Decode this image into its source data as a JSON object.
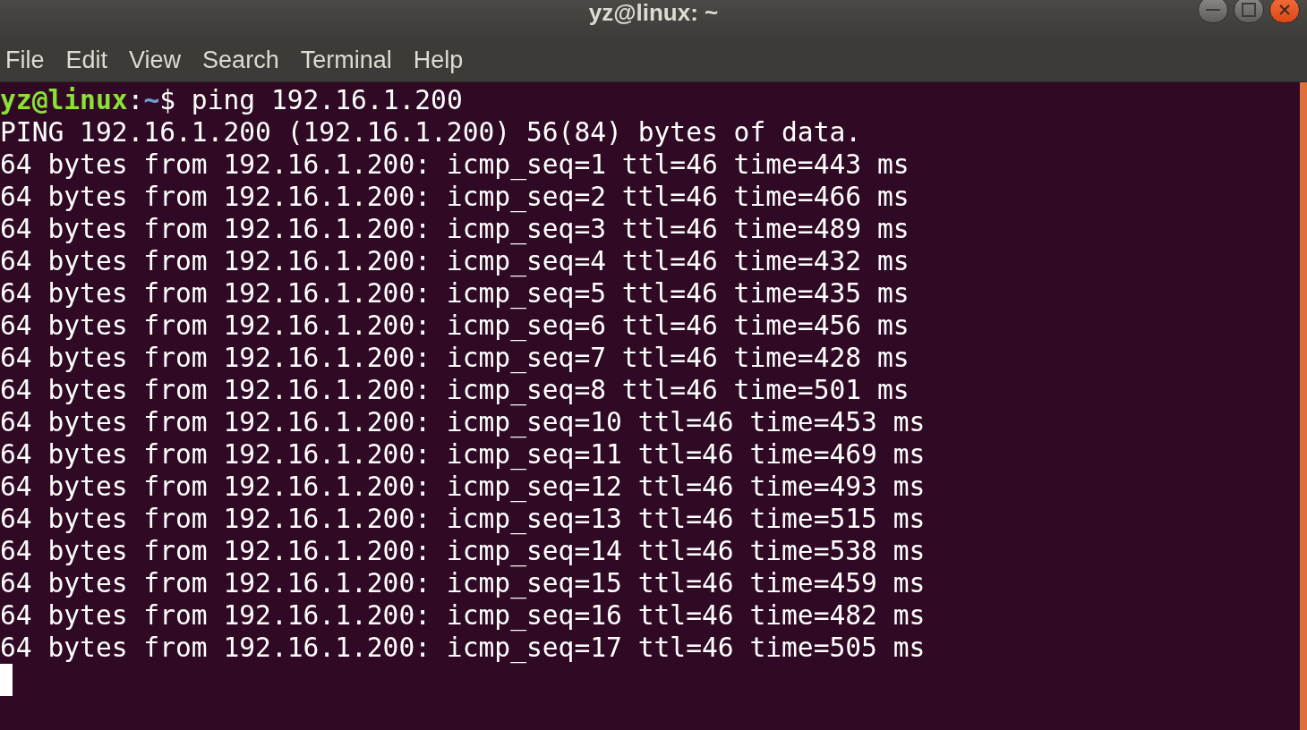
{
  "window": {
    "title": "yz@linux: ~"
  },
  "menu": [
    "File",
    "Edit",
    "View",
    "Search",
    "Terminal",
    "Help"
  ],
  "terminal": {
    "prompt": {
      "user_host": "yz@linux",
      "separator": ":",
      "path": "~",
      "command": "$ ping 192.16.1.200"
    },
    "output": [
      "PING 192.16.1.200 (192.16.1.200) 56(84) bytes of data.",
      "64 bytes from 192.16.1.200: icmp_seq=1 ttl=46 time=443 ms",
      "64 bytes from 192.16.1.200: icmp_seq=2 ttl=46 time=466 ms",
      "64 bytes from 192.16.1.200: icmp_seq=3 ttl=46 time=489 ms",
      "64 bytes from 192.16.1.200: icmp_seq=4 ttl=46 time=432 ms",
      "64 bytes from 192.16.1.200: icmp_seq=5 ttl=46 time=435 ms",
      "64 bytes from 192.16.1.200: icmp_seq=6 ttl=46 time=456 ms",
      "64 bytes from 192.16.1.200: icmp_seq=7 ttl=46 time=428 ms",
      "64 bytes from 192.16.1.200: icmp_seq=8 ttl=46 time=501 ms",
      "64 bytes from 192.16.1.200: icmp_seq=10 ttl=46 time=453 ms",
      "64 bytes from 192.16.1.200: icmp_seq=11 ttl=46 time=469 ms",
      "64 bytes from 192.16.1.200: icmp_seq=12 ttl=46 time=493 ms",
      "64 bytes from 192.16.1.200: icmp_seq=13 ttl=46 time=515 ms",
      "64 bytes from 192.16.1.200: icmp_seq=14 ttl=46 time=538 ms",
      "64 bytes from 192.16.1.200: icmp_seq=15 ttl=46 time=459 ms",
      "64 bytes from 192.16.1.200: icmp_seq=16 ttl=46 time=482 ms",
      "64 bytes from 192.16.1.200: icmp_seq=17 ttl=46 time=505 ms"
    ]
  }
}
